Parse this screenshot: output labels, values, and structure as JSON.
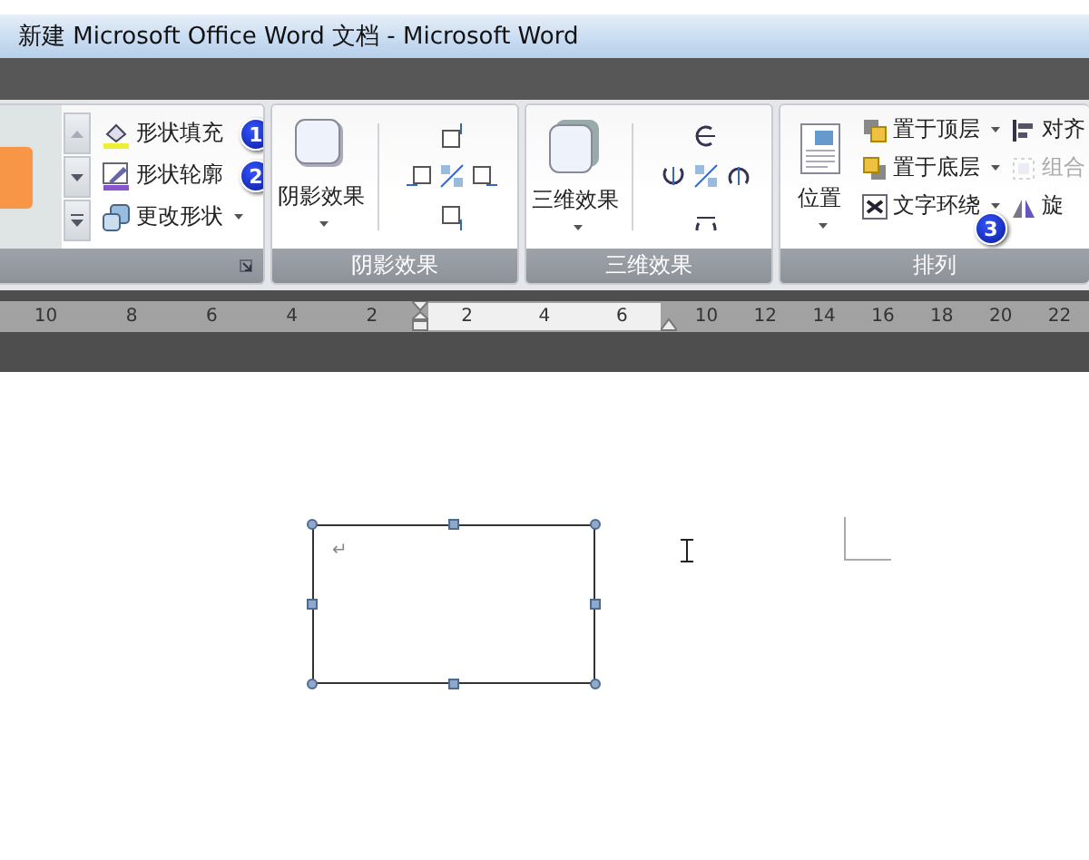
{
  "window": {
    "title": "新建 Microsoft Office Word 文档 - Microsoft Word"
  },
  "ribbon": {
    "groups": [
      {
        "kind": "shape_styles",
        "items": [
          {
            "label": "形状填充",
            "badge": "1",
            "dropdown": false
          },
          {
            "label": "形状轮廓",
            "badge": "2",
            "dropdown": false
          },
          {
            "label": "更改形状",
            "dropdown": true
          }
        ]
      },
      {
        "kind": "shadow",
        "label": "阴影效果",
        "title": "阴影效果"
      },
      {
        "kind": "threed",
        "label": "三维效果",
        "title": "三维效果"
      },
      {
        "kind": "arrange",
        "label": "位置",
        "title": "排列",
        "items": [
          {
            "label": "置于顶层",
            "dropdown": true,
            "disabled": false
          },
          {
            "label": "置于底层",
            "dropdown": true,
            "disabled": false
          },
          {
            "label": "文字环绕",
            "dropdown": true,
            "disabled": false,
            "badge": "3"
          },
          {
            "label": "对齐",
            "dropdown": false,
            "disabled": false
          },
          {
            "label": "组合",
            "dropdown": false,
            "disabled": true
          },
          {
            "label": "旋",
            "dropdown": false,
            "disabled": false
          }
        ]
      }
    ]
  },
  "ruler": {
    "left_labels": [
      "10",
      "8",
      "6",
      "4",
      "2"
    ],
    "text_labels": [
      "2",
      "4",
      "6"
    ],
    "right_labels": [
      "10",
      "12",
      "14",
      "16",
      "18",
      "20",
      "22"
    ]
  },
  "document": {
    "textbox": {
      "selected": true,
      "paragraph_mark": "↵"
    }
  }
}
